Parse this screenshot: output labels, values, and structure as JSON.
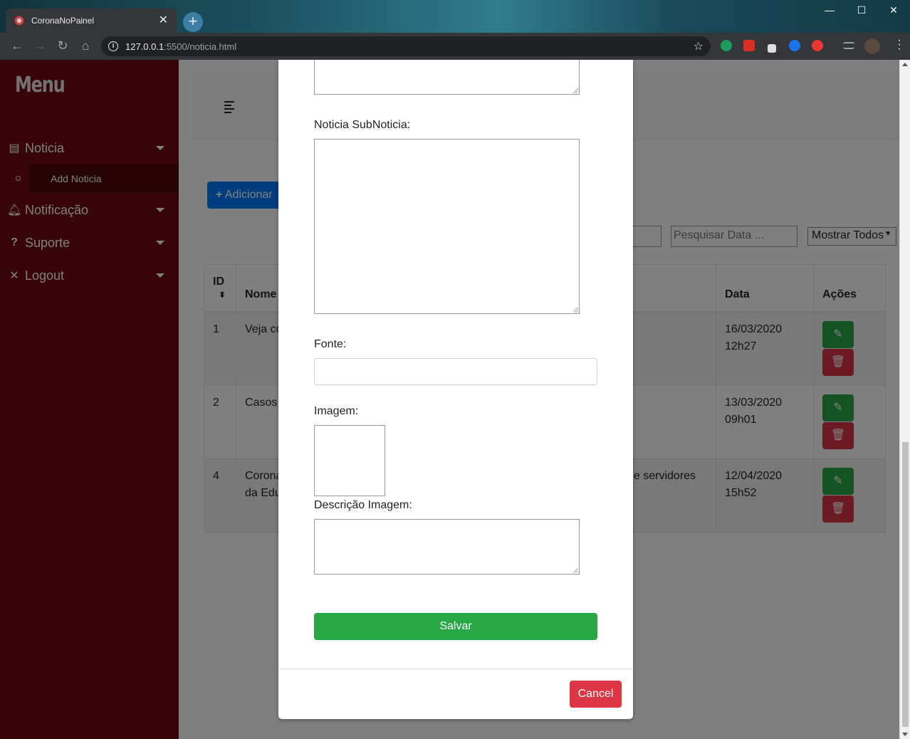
{
  "browser": {
    "tab_title": "CoronaNoPainel",
    "tab_close": "✕",
    "new_tab": "+",
    "url_host": "127.0.0.1",
    "url_path": ":5500/noticia.html",
    "window_controls": {
      "minimize": "—",
      "maximize": "☐",
      "close": "✕"
    }
  },
  "sidebar": {
    "brand": "Menu",
    "items": [
      {
        "label": "Noticia",
        "icon": "newspaper-icon"
      },
      {
        "label": "Notificação",
        "icon": "bell-icon"
      },
      {
        "label": "Suporte",
        "icon": "question-icon"
      },
      {
        "label": "Logout",
        "icon": "x-icon"
      }
    ],
    "subitem": "Add Noticia"
  },
  "content": {
    "add_button": "Adicionar",
    "search_date_placeholder": "Pesquisar Data ...",
    "filter_select": "Mostrar Todos"
  },
  "table": {
    "headers": {
      "id": "ID",
      "nome": "Nome",
      "data": "Data",
      "acoes": "Ações"
    },
    "rows": [
      {
        "id": "1",
        "nome": "Veja co",
        "nome2": "",
        "extra": "",
        "date": "16/03/2020",
        "time": "12h27"
      },
      {
        "id": "2",
        "nome": "Casos",
        "nome2": "",
        "extra": "",
        "date": "13/03/2020",
        "time": "09h01"
      },
      {
        "id": "4",
        "nome": "Corona",
        "nome2": "da Edu",
        "extra": "de servidores",
        "date": "12/04/2020",
        "time": "15h52"
      }
    ]
  },
  "modal": {
    "subnoticia_label": "Noticia SubNoticia:",
    "fonte_label": "Fonte:",
    "imagem_label": "Imagem:",
    "descricao_label": "Descrição Imagem:",
    "save_button": "Salvar",
    "cancel_button": "Cancel"
  },
  "colors": {
    "sidebar_bg": "#6e0a0e",
    "primary": "#007bff",
    "success": "#28a745",
    "danger": "#dc3545"
  }
}
